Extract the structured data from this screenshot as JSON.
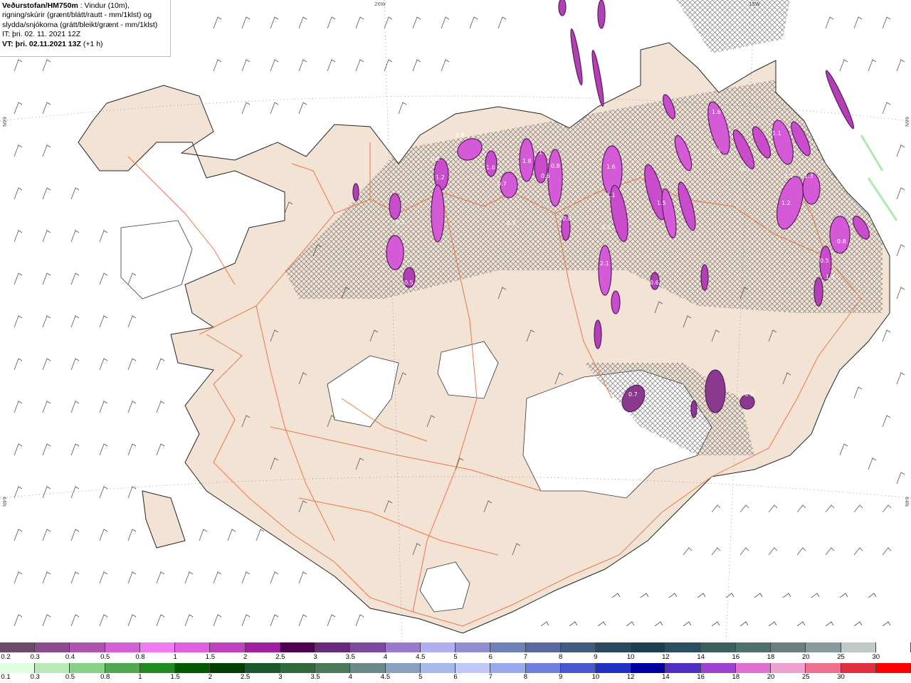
{
  "header": {
    "model": "Veðurstofan/HM750m",
    "desc1": " : Vindur (10m),",
    "desc2": "rigning/skúrir (grænt/blátt/rautt - mm/1klst) og",
    "desc3": "slydda/snjókoma (grátt/bleikt/grænt - mm/1klst)",
    "it_line": "IT: þri. 02. 11. 2021 12Z",
    "vt_label": "VT: þri. 02.11.2021 13Z",
    "vt_offset": "(+1 h)"
  },
  "grid_labels": {
    "lon20": "20W",
    "lon15": "15W",
    "lat66_left": "66N",
    "lat66_right": "66N",
    "lat64_left": "64N",
    "lat64_right": "64N"
  },
  "snow_scale": {
    "labels": [
      "0.2",
      "0.3",
      "0.4",
      "0.5",
      "0.8",
      "1",
      "1.5",
      "2",
      "2.5",
      "3",
      "3.5",
      "4",
      "4.5",
      "5",
      "6",
      "7",
      "8",
      "9",
      "10",
      "12",
      "14",
      "16",
      "18",
      "20",
      "25",
      "30"
    ],
    "colors": [
      "#6b4a6b",
      "#8b4a8b",
      "#b052b0",
      "#d460d4",
      "#f07af0",
      "#e060e0",
      "#c040c0",
      "#a020a0",
      "#500050",
      "#6a2a7a",
      "#7e4a9e",
      "#9a7acc",
      "#b0b0f0",
      "#9090d0",
      "#7080b8",
      "#5a6aa0",
      "#405a80",
      "#2a4a60",
      "#1a4050",
      "#2a5060",
      "#3a6060",
      "#507070",
      "#6a8080",
      "#8a9a9a",
      "#c0c8c8",
      "#ffffff"
    ]
  },
  "rain_scale": {
    "labels": [
      "0.1",
      "0.3",
      "0.5",
      "0.8",
      "1",
      "1.5",
      "2",
      "2.5",
      "3",
      "3.5",
      "4",
      "4.5",
      "5",
      "6",
      "7",
      "8",
      "9",
      "10",
      "12",
      "14",
      "16",
      "18",
      "20",
      "25",
      "30"
    ],
    "colors": [
      "#e0ffe0",
      "#b8eab8",
      "#88d088",
      "#50a850",
      "#208a20",
      "#005a00",
      "#004000",
      "#1a5a2a",
      "#306a3a",
      "#4a7a5a",
      "#6a8a8a",
      "#8aa0c0",
      "#a8b8e8",
      "#c0c8f8",
      "#9aa8f0",
      "#7080e0",
      "#4a58d0",
      "#2030c0",
      "#0000a0",
      "#5030c0",
      "#a040d0",
      "#e070d0",
      "#f0a0d0",
      "#f07090",
      "#e03040",
      "#ff0000"
    ]
  },
  "precip_labels": [
    "0.5",
    "1.2",
    "0.6",
    "0.8",
    "1.6",
    "1.8",
    "1",
    "0.7",
    "0.6",
    "0.8",
    "1.2",
    "1.6",
    "1.1",
    "0.5",
    "0.7",
    "1.5",
    "1.2",
    "0.5",
    "1.4",
    "0.8",
    "0.5",
    "2.1",
    "0.6",
    "0.7",
    "0.6",
    "0.5",
    "1.3",
    "1.1",
    "0.8",
    "0.5",
    "1.6"
  ],
  "colors": {
    "land": "#f3e3d4",
    "road": "#e8784a",
    "snow_purple": "#d45ad8",
    "snow_dark": "#8a3a8e",
    "hatch": "#6a6a6a",
    "glacier": "#ffffff"
  }
}
